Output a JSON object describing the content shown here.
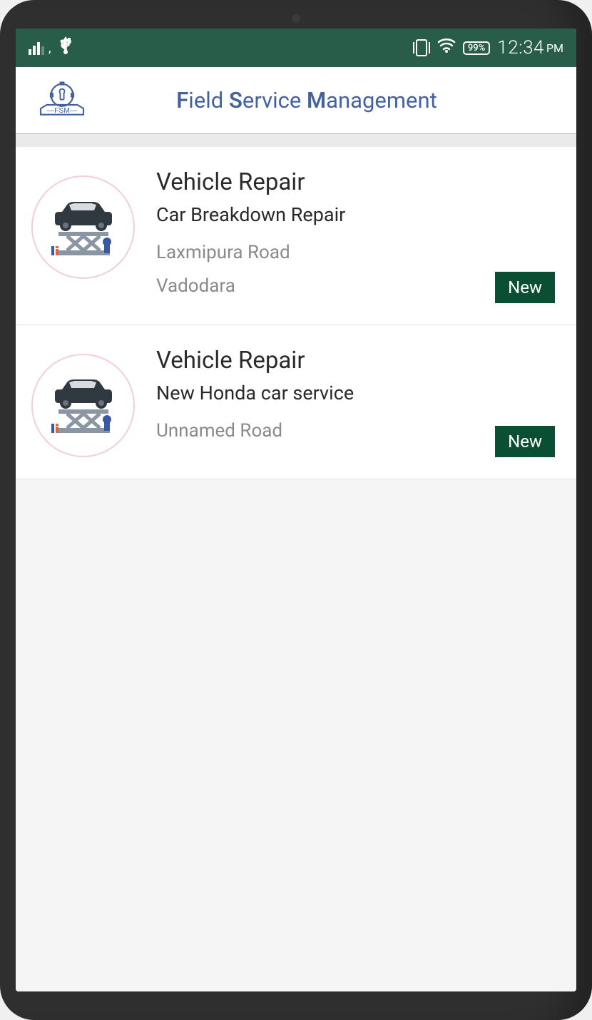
{
  "status_bar": {
    "battery": "99%",
    "time": "12:34",
    "period": "PM"
  },
  "header": {
    "logo_text": "FSM",
    "title_parts": {
      "f": "F",
      "field": "ield ",
      "s": "S",
      "service": "ervice ",
      "m": "M",
      "management": "anagement"
    }
  },
  "items": [
    {
      "title": "Vehicle Repair",
      "subtitle": "Car Breakdown Repair",
      "address_line1": "Laxmipura Road",
      "address_line2": "Vadodara",
      "status": "New"
    },
    {
      "title": "Vehicle Repair",
      "subtitle": "New Honda car service",
      "address_line1": "Unnamed Road",
      "address_line2": "",
      "status": "New"
    }
  ]
}
